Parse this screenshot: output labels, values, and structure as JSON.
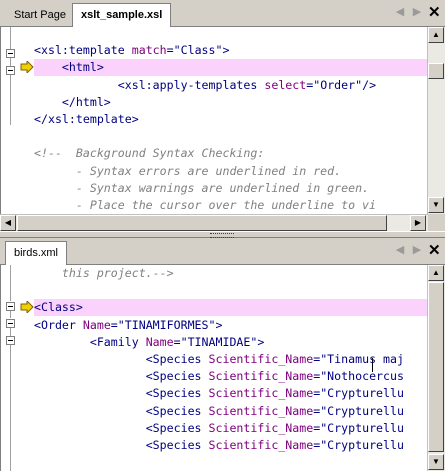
{
  "top_pane": {
    "tabs": [
      {
        "label": "Start Page"
      },
      {
        "label": "xslt_sample.xsl"
      }
    ],
    "lines": [
      {
        "text": ""
      },
      {
        "segments": [
          [
            "tag",
            "<xsl:template "
          ],
          [
            "attr",
            "match"
          ],
          [
            "tag",
            "="
          ],
          [
            "val",
            "\"Class\""
          ],
          [
            "tag",
            ">"
          ]
        ]
      },
      {
        "segments": [
          [
            "pad",
            "    "
          ],
          [
            "tag",
            "<html>"
          ]
        ],
        "highlight": true,
        "marker": true
      },
      {
        "segments": [
          [
            "pad",
            "            "
          ],
          [
            "tag",
            "<xsl:apply-templates "
          ],
          [
            "attr",
            "select"
          ],
          [
            "tag",
            "="
          ],
          [
            "val",
            "\"Order\""
          ],
          [
            "tag",
            "/>"
          ]
        ]
      },
      {
        "segments": [
          [
            "pad",
            "    "
          ],
          [
            "tag",
            "</html>"
          ]
        ]
      },
      {
        "segments": [
          [
            "tag",
            "</xsl:template>"
          ]
        ]
      },
      {
        "text": ""
      },
      {
        "segments": [
          [
            "cm",
            "<!--  Background Syntax Checking:"
          ]
        ]
      },
      {
        "segments": [
          [
            "cm",
            "      - Syntax errors are underlined in red."
          ]
        ]
      },
      {
        "segments": [
          [
            "cm",
            "      - Syntax warnings are underlined in green."
          ]
        ]
      },
      {
        "segments": [
          [
            "cm",
            "      - Place the cursor over the underline to vi"
          ]
        ]
      }
    ]
  },
  "bottom_pane": {
    "tabs": [
      {
        "label": "birds.xml"
      }
    ],
    "lines": [
      {
        "segments": [
          [
            "cm",
            "    this project.-->"
          ]
        ]
      },
      {
        "text": ""
      },
      {
        "segments": [
          [
            "tag",
            "<Class>"
          ]
        ],
        "highlight": true,
        "marker": true
      },
      {
        "segments": [
          [
            "tag",
            "<Order "
          ],
          [
            "attr",
            "Name"
          ],
          [
            "tag",
            "="
          ],
          [
            "val",
            "\"TINAMIFORMES\""
          ],
          [
            "tag",
            ">"
          ]
        ]
      },
      {
        "segments": [
          [
            "pad",
            "        "
          ],
          [
            "tag",
            "<Family "
          ],
          [
            "attr",
            "Name"
          ],
          [
            "tag",
            "="
          ],
          [
            "val",
            "\"TINAMIDAE\""
          ],
          [
            "tag",
            ">"
          ]
        ]
      },
      {
        "segments": [
          [
            "pad",
            "                "
          ],
          [
            "tag",
            "<Species "
          ],
          [
            "attr",
            "Scientific_Name"
          ],
          [
            "tag",
            "="
          ],
          [
            "val",
            "\"Tinamus maj"
          ]
        ]
      },
      {
        "segments": [
          [
            "pad",
            "                "
          ],
          [
            "tag",
            "<Species "
          ],
          [
            "attr",
            "Scientific_Name"
          ],
          [
            "tag",
            "="
          ],
          [
            "val",
            "\"Nothocercus"
          ]
        ]
      },
      {
        "segments": [
          [
            "pad",
            "                "
          ],
          [
            "tag",
            "<Species "
          ],
          [
            "attr",
            "Scientific_Name"
          ],
          [
            "tag",
            "="
          ],
          [
            "val",
            "\"Crypturellu"
          ]
        ]
      },
      {
        "segments": [
          [
            "pad",
            "                "
          ],
          [
            "tag",
            "<Species "
          ],
          [
            "attr",
            "Scientific_Name"
          ],
          [
            "tag",
            "="
          ],
          [
            "val",
            "\"Crypturellu"
          ]
        ]
      },
      {
        "segments": [
          [
            "pad",
            "                "
          ],
          [
            "tag",
            "<Species "
          ],
          [
            "attr",
            "Scientific_Name"
          ],
          [
            "tag",
            "="
          ],
          [
            "val",
            "\"Crypturellu"
          ]
        ]
      },
      {
        "segments": [
          [
            "pad",
            "                "
          ],
          [
            "tag",
            "<Species "
          ],
          [
            "attr",
            "Scientific_Name"
          ],
          [
            "tag",
            "="
          ],
          [
            "val",
            "\"Crypturellu"
          ]
        ]
      }
    ]
  },
  "icons": {
    "tab_prev": "◀",
    "tab_next": "▶",
    "tab_close": "✕",
    "scroll_up": "▲",
    "scroll_down": "▼",
    "scroll_left": "◀",
    "scroll_right": "▶"
  },
  "colors": {
    "highlight": "#fbd2fb",
    "tag": "#000080",
    "attr": "#800080",
    "comment": "#808080",
    "marker": "#f0d000"
  }
}
